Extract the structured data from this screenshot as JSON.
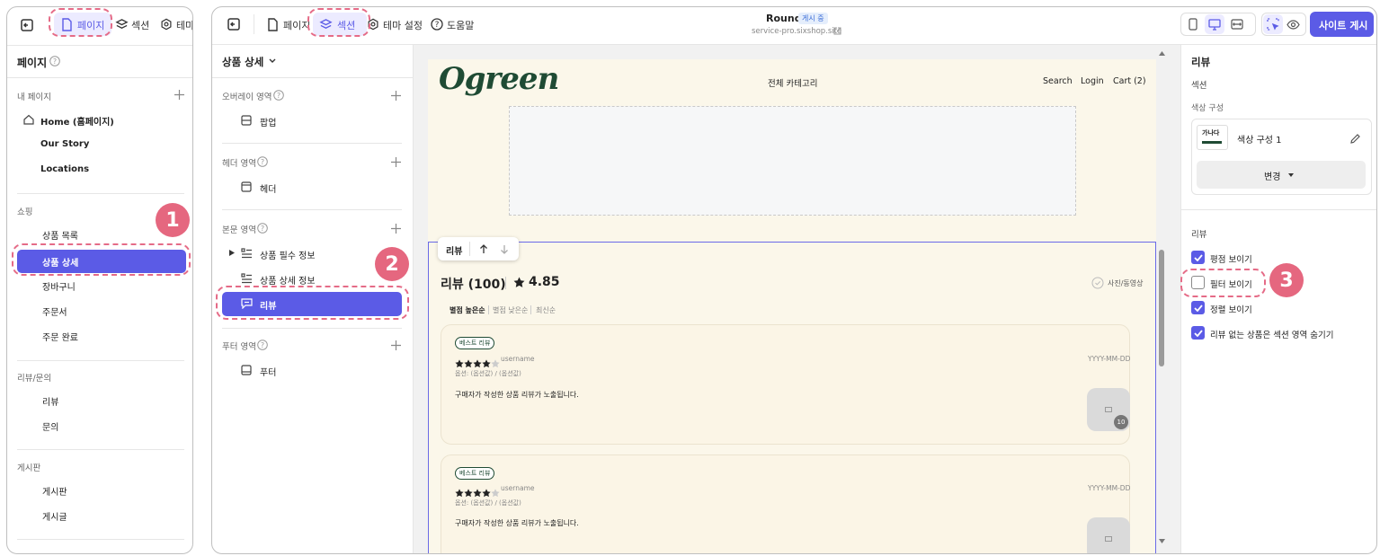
{
  "left_window": {
    "top_tabs": [
      {
        "label": "페이지"
      },
      {
        "label": "섹션"
      },
      {
        "label": "테마"
      }
    ],
    "title": "페이지",
    "my_pages": {
      "heading": "내 페이지",
      "items": [
        {
          "label": "Home (홈페이지)"
        },
        {
          "label": "Our Story"
        },
        {
          "label": "Locations"
        }
      ]
    },
    "shopping": {
      "heading": "쇼핑",
      "items": [
        {
          "label": "상품 목록"
        },
        {
          "label": "상품 상세"
        },
        {
          "label": "장바구니"
        },
        {
          "label": "주문서"
        },
        {
          "label": "주문 완료"
        }
      ]
    },
    "reviews": {
      "heading": "리뷰/문의",
      "items": [
        {
          "label": "리뷰"
        },
        {
          "label": "문의"
        }
      ]
    },
    "board": {
      "heading": "게시판",
      "items": [
        {
          "label": "게시판"
        },
        {
          "label": "게시글"
        }
      ]
    }
  },
  "topbar": {
    "tabs": [
      {
        "label": "페이지"
      },
      {
        "label": "섹션"
      },
      {
        "label": "테마 설정"
      },
      {
        "label": "도움말"
      }
    ],
    "site_name": "Round",
    "status_badge": "게시 중",
    "site_url": "service-pro.sixshop.site",
    "publish_label": "사이트 게시"
  },
  "section_panel": {
    "page_selector": "상품 상세",
    "groups": [
      {
        "heading": "오버레이 영역",
        "items": [
          {
            "label": "팝업"
          }
        ]
      },
      {
        "heading": "헤더 영역",
        "items": [
          {
            "label": "헤더"
          }
        ]
      },
      {
        "heading": "본문 영역",
        "items": [
          {
            "label": "상품 필수 정보"
          },
          {
            "label": "상품 상세 정보"
          },
          {
            "label": "리뷰"
          }
        ]
      },
      {
        "heading": "푸터 영역",
        "items": [
          {
            "label": "푸터"
          }
        ]
      }
    ]
  },
  "preview": {
    "logo": "Ogreen",
    "nav_center": "전체 카테고리",
    "nav_links": [
      {
        "label": "Search"
      },
      {
        "label": "Login"
      },
      {
        "label": "Cart (2)"
      }
    ],
    "section_toolbar_label": "리뷰",
    "review_title": "리뷰 (100)",
    "rating": "4.85",
    "photo_filter": "사진/동영상",
    "sort_options": [
      {
        "label": "별점 높은순"
      },
      {
        "label": "별점 낮은순"
      },
      {
        "label": "최신순"
      }
    ],
    "reviews": [
      {
        "badge": "베스트 리뷰",
        "username": "username",
        "date": "YYYY-MM-DD",
        "options": "옵션: (옵션값) / (옵션값)",
        "body": "구매자가 작성한 상품 리뷰가 노출됩니다.",
        "image_count": "10",
        "stars": 4
      },
      {
        "badge": "베스트 리뷰",
        "username": "username",
        "date": "YYYY-MM-DD",
        "options": "옵션: (옵션값) / (옵션값)",
        "body": "구매자가 작성한 상품 리뷰가 노출됩니다.",
        "stars": 4
      }
    ]
  },
  "settings_panel": {
    "title": "리뷰",
    "section_label": "섹션",
    "color_label": "색상 구성",
    "color_swatch_text": "가나다",
    "color_name": "색상 구성 1",
    "change_button": "변경",
    "review_heading": "리뷰",
    "options": [
      {
        "label": "평점 보이기",
        "checked": true
      },
      {
        "label": "필터 보이기",
        "checked": false
      },
      {
        "label": "정렬 보이기",
        "checked": true
      },
      {
        "label": "리뷰 없는 상품은 섹션 영역 숨기기",
        "checked": true
      }
    ]
  },
  "callouts": [
    "1",
    "2",
    "3"
  ],
  "colors": {
    "accent": "#5b5be6",
    "callout": "#e5677f",
    "preview_bg": "#fbf7ea",
    "logo": "#1f4b34"
  }
}
